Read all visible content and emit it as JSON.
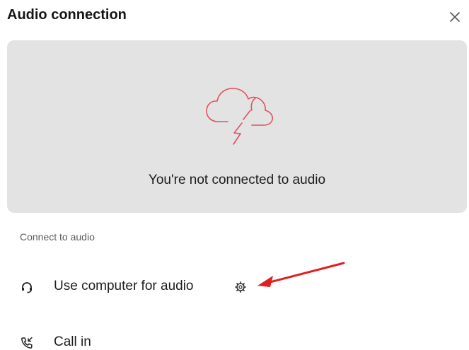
{
  "dialog": {
    "title": "Audio connection",
    "close_icon": "close-icon"
  },
  "status": {
    "icon": "cloud-lightning-icon",
    "message": "You're not connected to audio",
    "accent_color": "#e0525e"
  },
  "connect": {
    "section_label": "Connect to audio",
    "options": [
      {
        "icon": "headset-icon",
        "label": "Use computer for audio",
        "settings_icon": "gear-icon"
      },
      {
        "icon": "phone-call-in-icon",
        "label": "Call in"
      }
    ]
  },
  "annotation": {
    "arrow_icon": "red-arrow",
    "color": "#e02020"
  }
}
